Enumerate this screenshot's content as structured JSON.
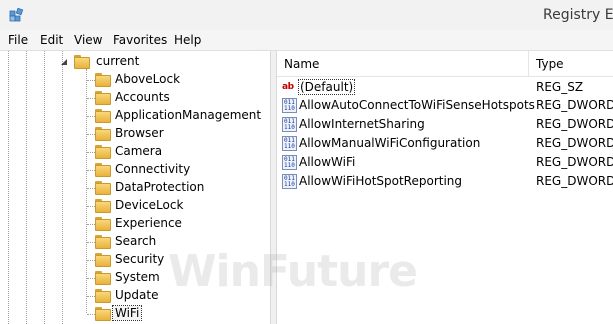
{
  "window": {
    "title": "Registry Ed",
    "app_icon": "registry-editor-icon"
  },
  "menu": {
    "items": [
      "File",
      "Edit",
      "View",
      "Favorites",
      "Help"
    ]
  },
  "tree": {
    "parent": "current",
    "children": [
      "AboveLock",
      "Accounts",
      "ApplicationManagement",
      "Browser",
      "Camera",
      "Connectivity",
      "DataProtection",
      "DeviceLock",
      "Experience",
      "Search",
      "Security",
      "System",
      "Update",
      "WiFi"
    ],
    "selected": "WiFi"
  },
  "values": {
    "columns": [
      "Name",
      "Type"
    ],
    "rows": [
      {
        "name": "(Default)",
        "type": "REG_SZ",
        "icon": "string-value-icon"
      },
      {
        "name": "AllowAutoConnectToWiFiSenseHotspots",
        "type": "REG_DWORD",
        "icon": "binary-value-icon"
      },
      {
        "name": "AllowInternetSharing",
        "type": "REG_DWORD",
        "icon": "binary-value-icon"
      },
      {
        "name": "AllowManualWiFiConfiguration",
        "type": "REG_DWORD",
        "icon": "binary-value-icon"
      },
      {
        "name": "AllowWiFi",
        "type": "REG_DWORD",
        "icon": "binary-value-icon"
      },
      {
        "name": "AllowWiFiHotSpotReporting",
        "type": "REG_DWORD",
        "icon": "binary-value-icon"
      }
    ]
  },
  "watermark": "WinFuture",
  "colors": {
    "folder": "#f5c55a",
    "string_icon": "#c00000",
    "dword_icon": "#1a3aa0"
  }
}
